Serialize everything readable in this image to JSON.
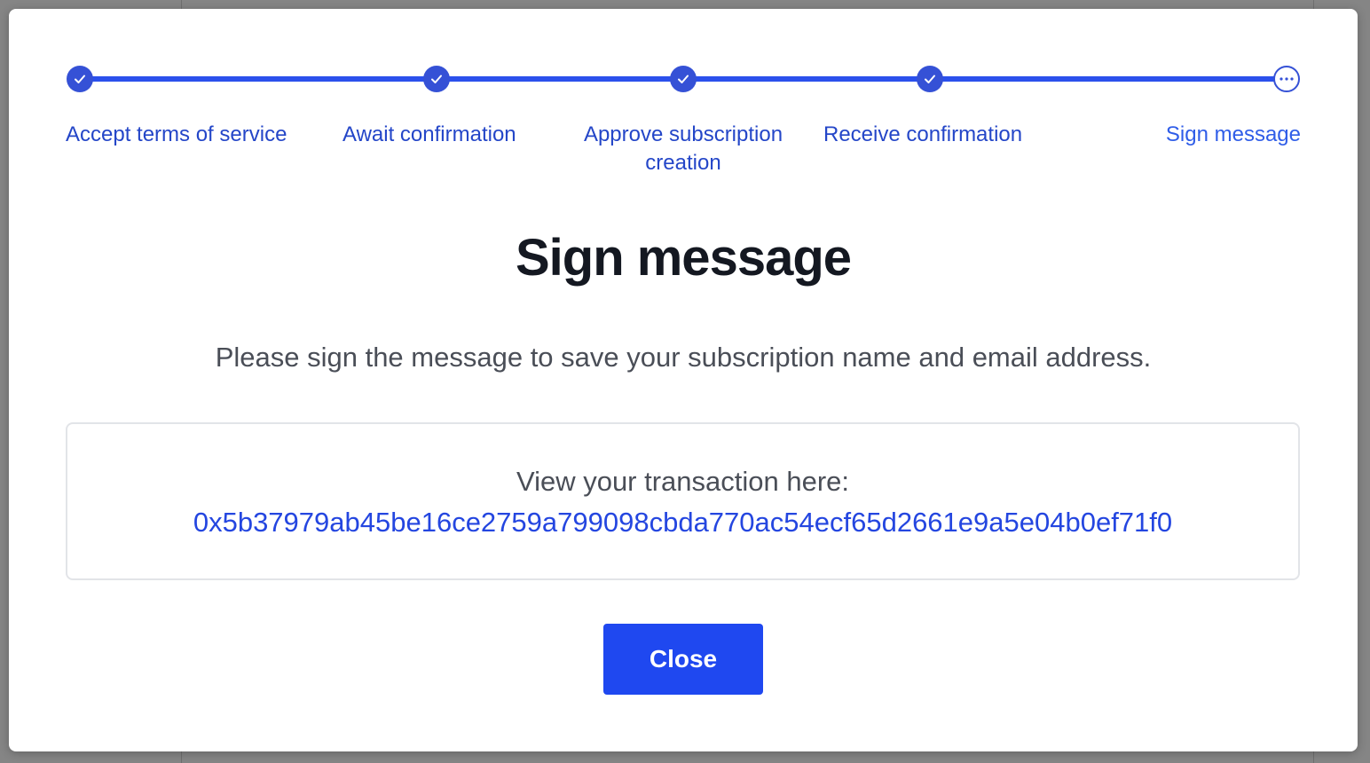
{
  "stepper": {
    "steps": [
      {
        "label": "Accept terms of service",
        "status": "completed"
      },
      {
        "label": "Await confirmation",
        "status": "completed"
      },
      {
        "label": "Approve subscription creation",
        "status": "completed"
      },
      {
        "label": "Receive confirmation",
        "status": "completed"
      },
      {
        "label": "Sign message",
        "status": "current"
      }
    ]
  },
  "modal": {
    "title": "Sign message",
    "description": "Please sign the message to save your subscription name and email address.",
    "transaction": {
      "label": "View your transaction here:",
      "hash": "0x5b37979ab45be16ce2759a799098cbda770ac54ecf65d2661e9a5e04b0ef71f0"
    },
    "close_label": "Close"
  },
  "colors": {
    "accent": "#2b50ec",
    "step_label": "#2446c8",
    "primary_button": "#1f48f0",
    "title": "#141821",
    "body_text": "#4a4e57"
  }
}
